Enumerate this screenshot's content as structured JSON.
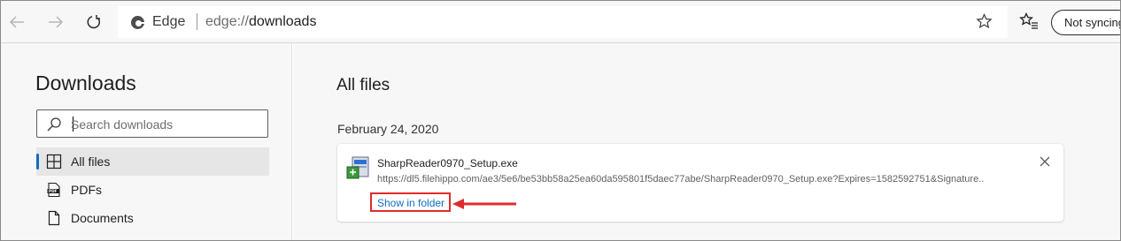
{
  "browser": {
    "site_name": "Edge",
    "url_scheme": "edge://",
    "url_path": "downloads",
    "sync_label": "Not syncing"
  },
  "sidebar": {
    "title": "Downloads",
    "search": {
      "placeholder": "Search downloads",
      "value": ""
    },
    "items": [
      {
        "label": "All files",
        "icon": "grid-icon",
        "active": true
      },
      {
        "label": "PDFs",
        "icon": "pdf-icon",
        "active": false
      },
      {
        "label": "Documents",
        "icon": "document-icon",
        "active": false
      }
    ]
  },
  "main": {
    "title": "All files",
    "groups": [
      {
        "date": "February 24, 2020",
        "items": [
          {
            "filename": "SharpReader0970_Setup.exe",
            "url": "https://dl5.filehippo.com/ae3/5e6/be53bb58a25ea60da595801f5daec77abe/SharpReader0970_Setup.exe?Expires=1582592751&Signature..",
            "action_label": "Show in folder",
            "icon": "installer-icon"
          }
        ]
      }
    ]
  },
  "annotation": {
    "highlight_color": "#e02b2b"
  },
  "colors": {
    "accent": "#0f6cbd",
    "background": "#f7f7f7"
  }
}
